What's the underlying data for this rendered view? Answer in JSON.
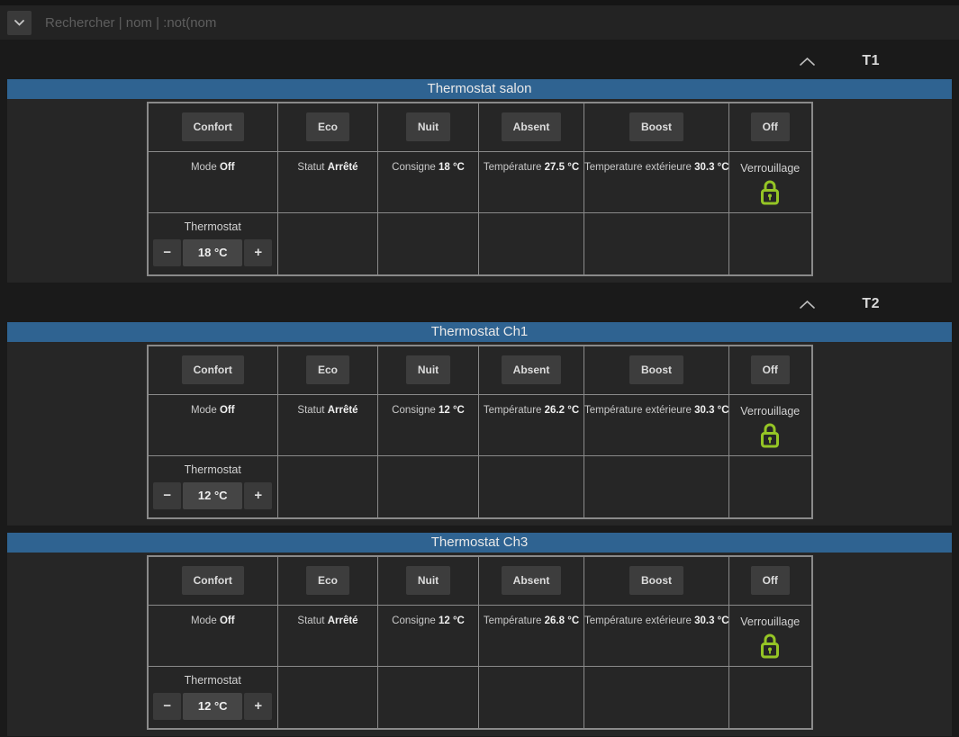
{
  "topbar": {
    "search_placeholder": "Rechercher | nom | :not(nom"
  },
  "stepper_labels": {
    "minus": "−",
    "plus": "+"
  },
  "icons": {
    "search_dropdown": "chevron-down",
    "section_collapse": "chevron-up",
    "lock": "lock-closed"
  },
  "colors": {
    "accent_blue": "#2f6391",
    "lock_green": "#95c525",
    "panel_bg": "#262626",
    "page_bg": "#1a1a1a"
  },
  "sections": [
    {
      "label": "T1",
      "panels": [
        {
          "title": "Thermostat salon",
          "mode_buttons": [
            "Confort",
            "Eco",
            "Nuit",
            "Absent",
            "Boost",
            "Off"
          ],
          "status_cells": [
            {
              "label": "Mode",
              "value": "Off"
            },
            {
              "label": "Statut",
              "value": "Arrêté"
            },
            {
              "label": "Consigne",
              "value": "18 °C"
            },
            {
              "label": "Température",
              "value": "27.5 °C"
            },
            {
              "label": "Temperature extérieure",
              "value": "30.3 °C"
            },
            {
              "label": "Verrouillage",
              "icon": "lock-icon"
            }
          ],
          "thermostat": {
            "label": "Thermostat",
            "value": "18 °C"
          }
        }
      ]
    },
    {
      "label": "T2",
      "panels": [
        {
          "title": "Thermostat Ch1",
          "mode_buttons": [
            "Confort",
            "Eco",
            "Nuit",
            "Absent",
            "Boost",
            "Off"
          ],
          "status_cells": [
            {
              "label": "Mode",
              "value": "Off"
            },
            {
              "label": "Statut",
              "value": "Arrêté"
            },
            {
              "label": "Consigne",
              "value": "12 °C"
            },
            {
              "label": "Température",
              "value": "26.2 °C"
            },
            {
              "label": "Température extérieure",
              "value": "30.3 °C"
            },
            {
              "label": "Verrouillage",
              "icon": "lock-icon"
            }
          ],
          "thermostat": {
            "label": "Thermostat",
            "value": "12 °C"
          }
        },
        {
          "title": "Thermostat Ch3",
          "mode_buttons": [
            "Confort",
            "Eco",
            "Nuit",
            "Absent",
            "Boost",
            "Off"
          ],
          "status_cells": [
            {
              "label": "Mode",
              "value": "Off"
            },
            {
              "label": "Statut",
              "value": "Arrêté"
            },
            {
              "label": "Consigne",
              "value": "12 °C"
            },
            {
              "label": "Température",
              "value": "26.8 °C"
            },
            {
              "label": "Température extérieure",
              "value": "30.3 °C"
            },
            {
              "label": "Verrouillage",
              "icon": "lock-icon"
            }
          ],
          "thermostat": {
            "label": "Thermostat",
            "value": "12 °C"
          }
        }
      ]
    }
  ]
}
